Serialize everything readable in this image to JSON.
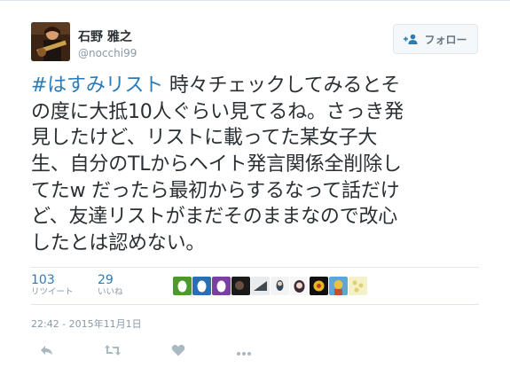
{
  "user": {
    "display_name": "石野 雅之",
    "handle": "@nocchi99"
  },
  "follow_button": {
    "label": "フォロー"
  },
  "tweet": {
    "hashtag": "#はすみリスト",
    "lines": [
      " 時々チェックしてみるとそ",
      "の度に大抵10人ぐらい見てるね。さっき発",
      "見したけど、リストに載ってた某女子大",
      "生、自分のTLからヘイト発言関係全削除し",
      "てたw だったら最初からするなって話だけ",
      "ど、友達リストがまだそのままなので改心",
      "したとは認めない。"
    ]
  },
  "stats": {
    "retweets": {
      "count": "103",
      "label": "リツイート"
    },
    "likes": {
      "count": "29",
      "label": "いいね"
    }
  },
  "timestamp": "22:42 - 2015年11月1日",
  "colors": {
    "link": "#2b7bb9",
    "muted": "#8899a6",
    "text": "#292f33",
    "border": "#e1e8ed"
  }
}
